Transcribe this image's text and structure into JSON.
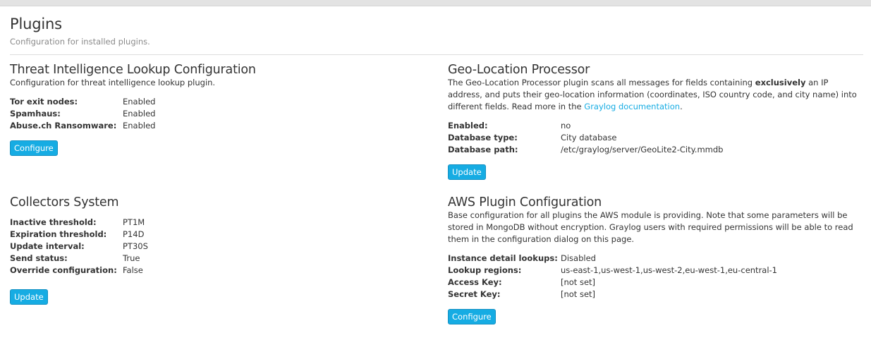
{
  "page": {
    "title": "Plugins",
    "subtitle": "Configuration for installed plugins."
  },
  "threat": {
    "title": "Threat Intelligence Lookup Configuration",
    "description": "Configuration for threat intelligence lookup plugin.",
    "props": [
      {
        "label": "Tor exit nodes:",
        "value": "Enabled"
      },
      {
        "label": "Spamhaus:",
        "value": "Enabled"
      },
      {
        "label": "Abuse.ch Ransomware:",
        "value": "Enabled"
      }
    ],
    "button": "Configure"
  },
  "collectors": {
    "title": "Collectors System",
    "props": [
      {
        "label": "Inactive threshold:",
        "value": "PT1M"
      },
      {
        "label": "Expiration threshold:",
        "value": "P14D"
      },
      {
        "label": "Update interval:",
        "value": "PT30S"
      },
      {
        "label": "Send status:",
        "value": "True"
      },
      {
        "label": "Override configuration:",
        "value": "False"
      }
    ],
    "button": "Update"
  },
  "geo": {
    "title": "Geo-Location Processor",
    "desc_part1": "The Geo-Location Processor plugin scans all messages for fields containing ",
    "desc_bold": "exclusively",
    "desc_part2": " an IP address, and puts their geo-location information (coordinates, ISO country code, and city name) into different fields. Read more in the ",
    "desc_link": "Graylog documentation",
    "desc_part3": ".",
    "props": [
      {
        "label": "Enabled:",
        "value": "no"
      },
      {
        "label": "Database type:",
        "value": "City database"
      },
      {
        "label": "Database path:",
        "value": "/etc/graylog/server/GeoLite2-City.mmdb"
      }
    ],
    "button": "Update"
  },
  "aws": {
    "title": "AWS Plugin Configuration",
    "description": "Base configuration for all plugins the AWS module is providing. Note that some parameters will be stored in MongoDB without encryption. Graylog users with required permissions will be able to read them in the configuration dialog on this page.",
    "props": [
      {
        "label": "Instance detail lookups:",
        "value": "Disabled"
      },
      {
        "label": "Lookup regions:",
        "value": "us-east-1,us-west-1,us-west-2,eu-west-1,eu-central-1"
      },
      {
        "label": "Access Key:",
        "value": "[not set]"
      },
      {
        "label": "Secret Key:",
        "value": "[not set]"
      }
    ],
    "button": "Configure"
  },
  "colors": {
    "accent": "#16ace3",
    "text": "#333333",
    "muted": "#8a8a8a"
  }
}
